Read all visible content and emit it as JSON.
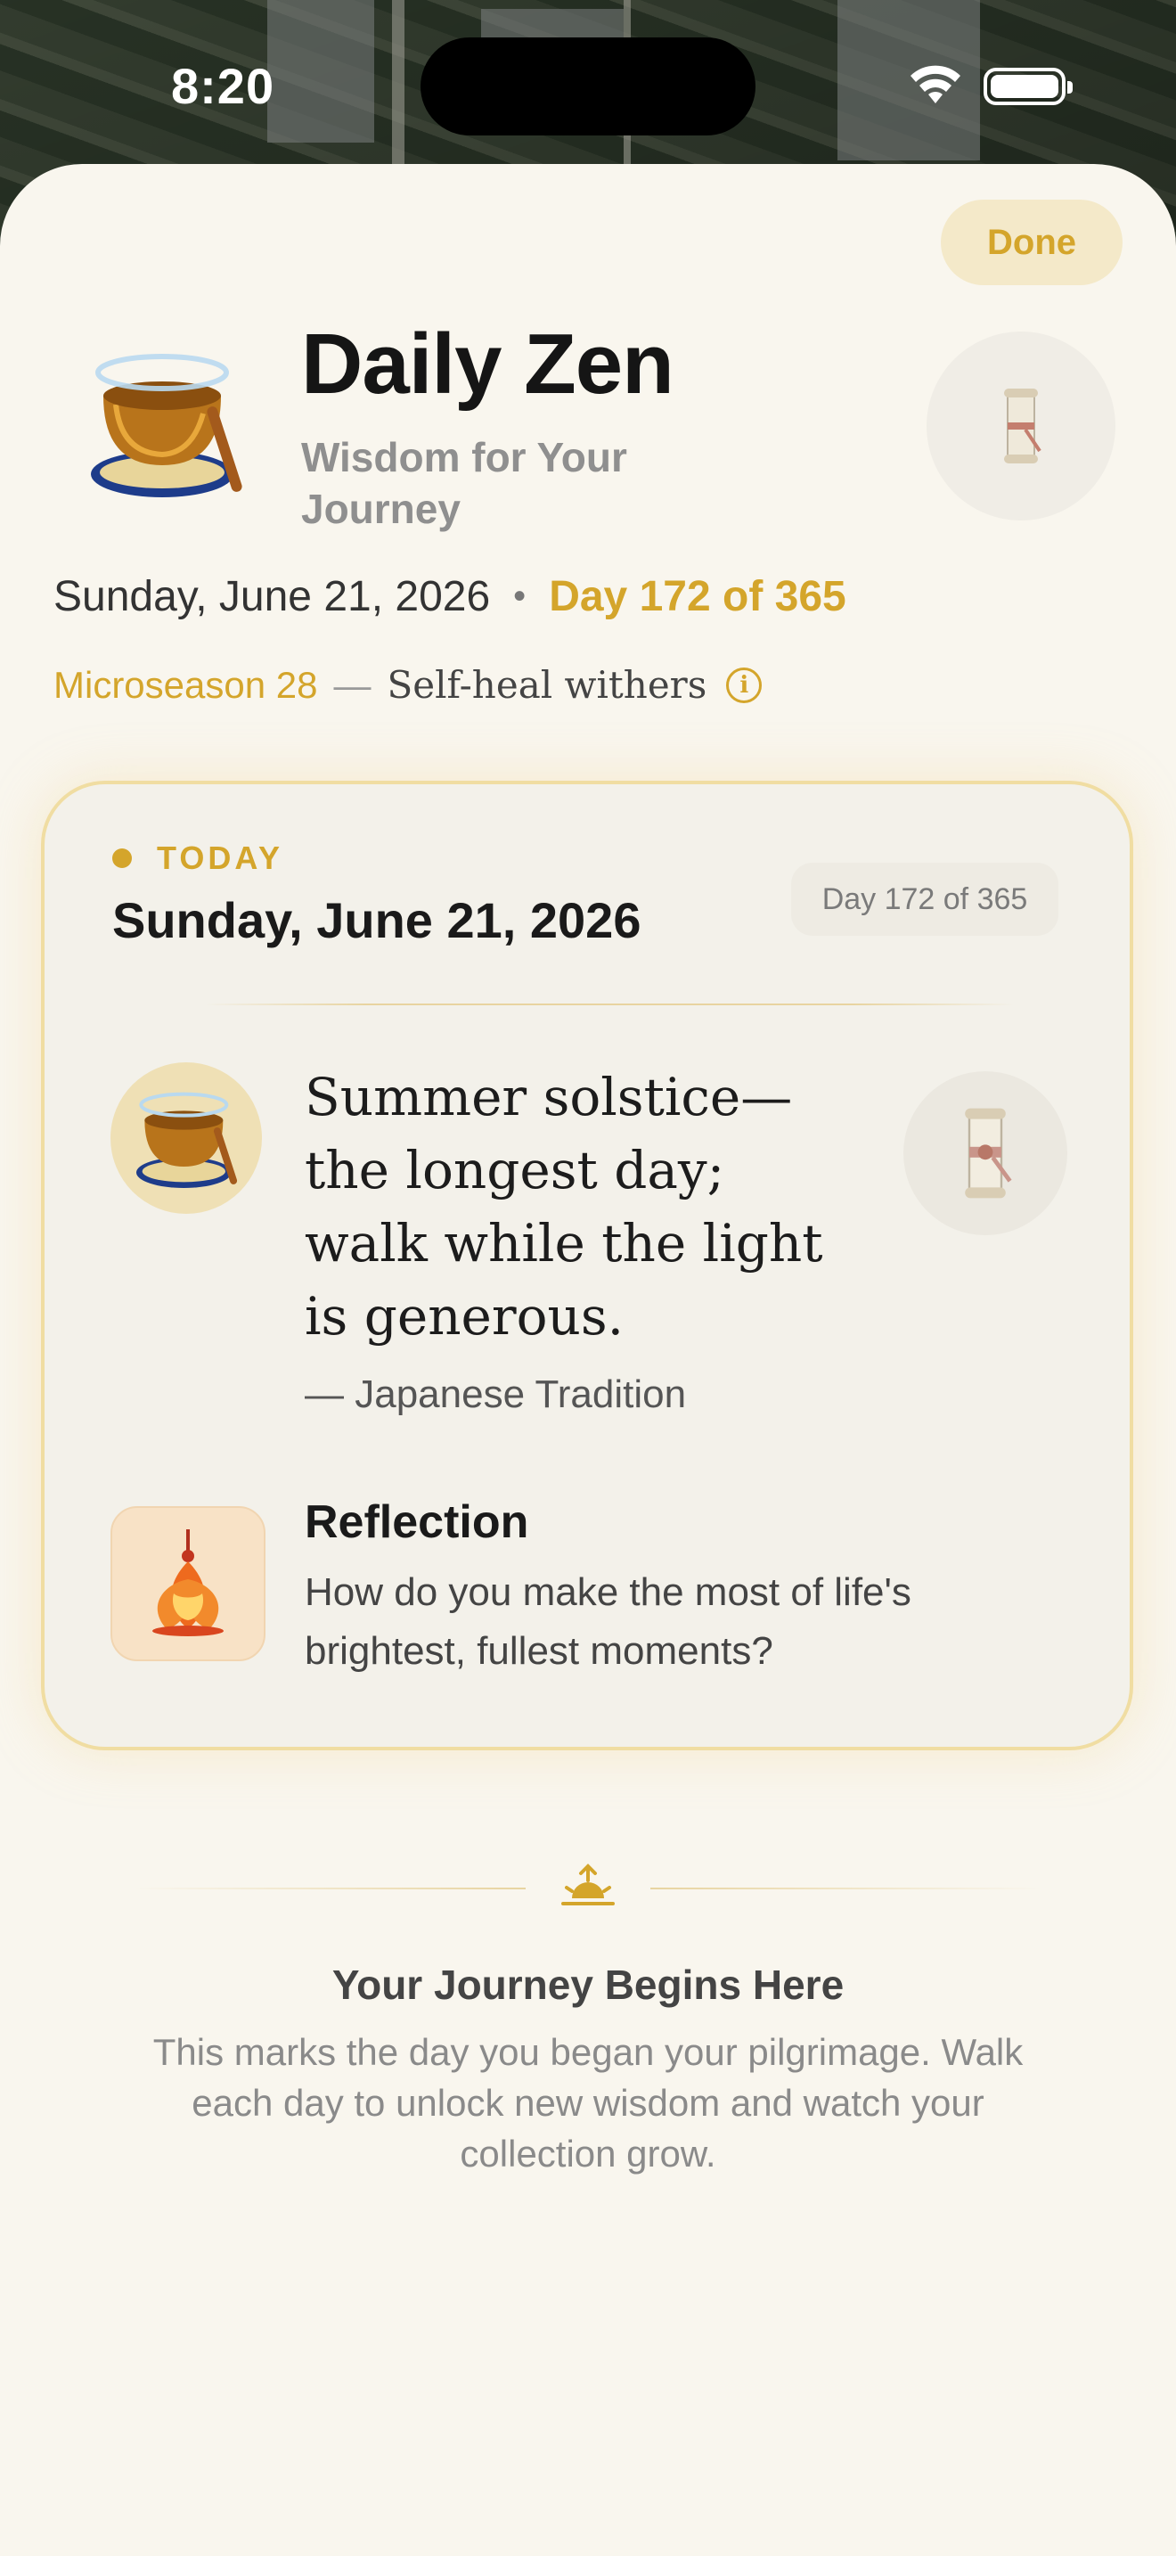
{
  "status_bar": {
    "time": "8:20"
  },
  "header": {
    "done_label": "Done",
    "title": "Daily Zen",
    "subtitle": "Wisdom for Your Journey",
    "date": "Sunday, June 21, 2026",
    "day_progress": "Day 172 of 365",
    "microseason_label": "Microseason 28",
    "microseason_name": "Self-heal withers"
  },
  "card": {
    "today_label": "TODAY",
    "date": "Sunday, June 21, 2026",
    "day_badge": "Day 172 of 365",
    "quote": "Summer solstice— the longest day; walk while the light is generous.",
    "attribution": "— Japanese Tradition",
    "reflection_title": "Reflection",
    "reflection_text": "How do you make the most of life's brightest, fullest moments?"
  },
  "journey": {
    "title": "Your Journey Begins Here",
    "text": "This marks the day you began your pilgrimage. Walk each day to unlock new wisdom and watch your collection grow."
  },
  "colors": {
    "accent": "#d4a52b",
    "sheet_bg": "#f9f6ee",
    "card_border": "#f0dda2"
  },
  "icons": [
    "singing-bowl-icon",
    "scroll-icon",
    "lotus-lantern-icon",
    "sunrise-icon",
    "info-icon",
    "wifi-icon",
    "battery-icon"
  ]
}
